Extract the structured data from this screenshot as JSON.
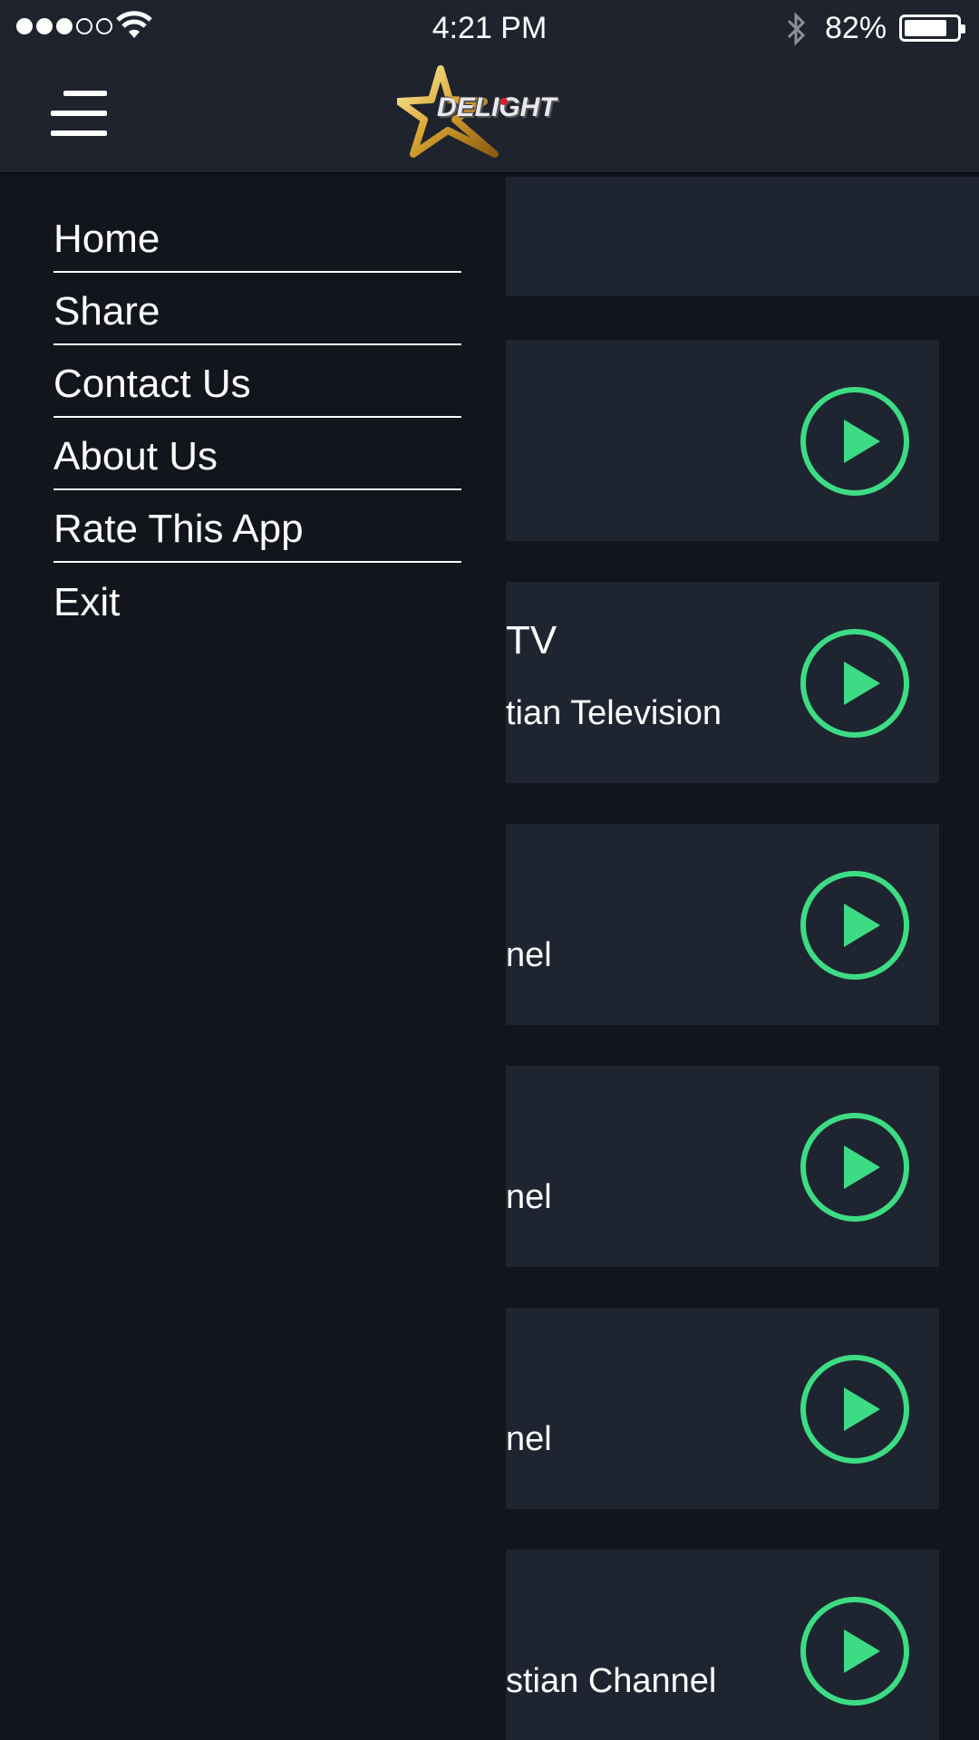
{
  "status_bar": {
    "time": "4:21 PM",
    "battery": "82%",
    "battery_level": 0.82
  },
  "header": {
    "logo_text": "DELIGHT",
    "menu_icon": "hamburger-menu-icon"
  },
  "drawer": {
    "items": [
      {
        "label": "Home"
      },
      {
        "label": "Share"
      },
      {
        "label": "Contact Us"
      },
      {
        "label": "About Us"
      },
      {
        "label": "Rate This App"
      },
      {
        "label": "Exit"
      }
    ]
  },
  "content": {
    "cards": [
      {
        "title": "",
        "subtitle": ""
      },
      {
        "title": "TV",
        "subtitle": "tian Television"
      },
      {
        "title": "",
        "subtitle": "nel"
      },
      {
        "title": "",
        "subtitle": "nel"
      },
      {
        "title": "",
        "subtitle": "nel"
      },
      {
        "title": "",
        "subtitle": "stian Channel"
      }
    ],
    "play_icon": "play-circle-icon"
  },
  "colors": {
    "accent": "#3ddc84",
    "background": "#12151c",
    "card": "#1f2530",
    "header": "#1e232d"
  }
}
